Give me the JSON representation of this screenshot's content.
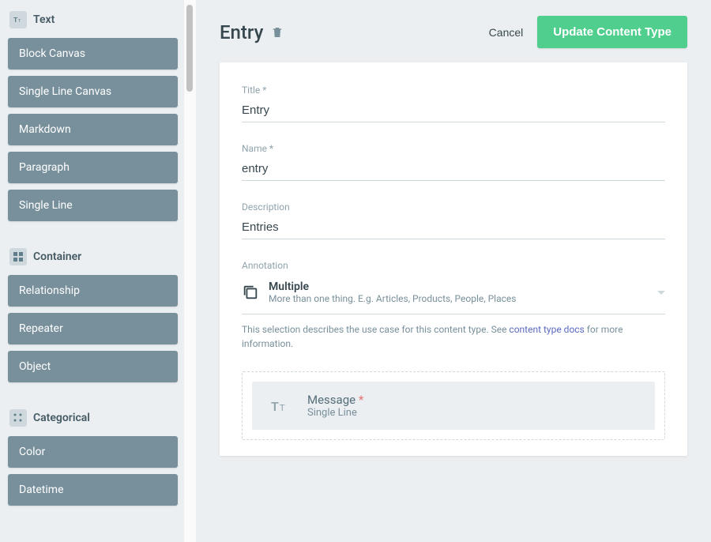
{
  "sidebar": {
    "groups": [
      {
        "icon": "text",
        "title": "Text",
        "items": [
          "Block Canvas",
          "Single Line Canvas",
          "Markdown",
          "Paragraph",
          "Single Line"
        ]
      },
      {
        "icon": "container",
        "title": "Container",
        "items": [
          "Relationship",
          "Repeater",
          "Object"
        ]
      },
      {
        "icon": "categorical",
        "title": "Categorical",
        "items": [
          "Color",
          "Datetime"
        ]
      }
    ]
  },
  "header": {
    "title": "Entry",
    "cancel_label": "Cancel",
    "submit_label": "Update Content Type"
  },
  "form": {
    "title_label": "Title *",
    "title_value": "Entry",
    "name_label": "Name *",
    "name_value": "entry",
    "description_label": "Description",
    "description_value": "Entries",
    "annotation_label": "Annotation",
    "annotation": {
      "title": "Multiple",
      "subtitle": "More than one thing. E.g. Articles, Products, People, Places"
    },
    "help_prefix": "This selection describes the use case for this content type. See ",
    "help_link_text": "content type docs",
    "help_suffix": " for more information."
  },
  "dropzone": {
    "field_title": "Message",
    "field_required": "*",
    "field_type": "Single Line"
  }
}
